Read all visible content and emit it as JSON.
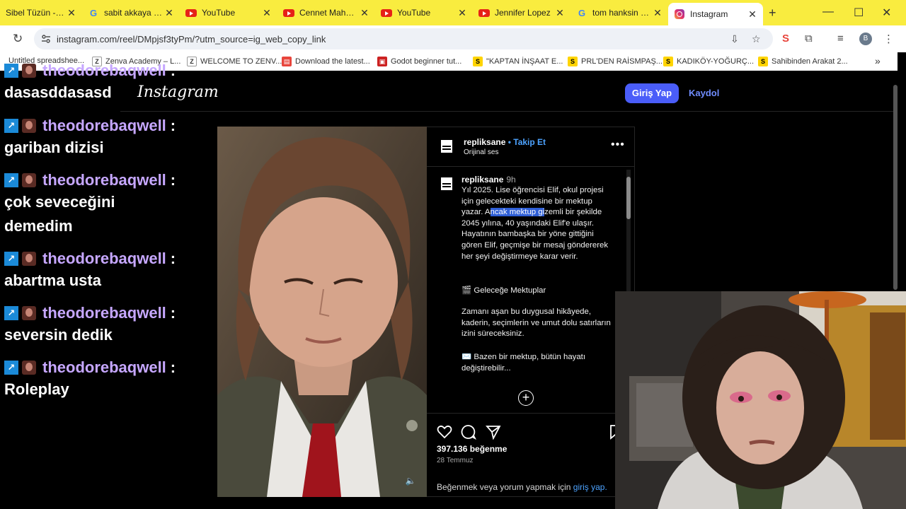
{
  "browser": {
    "tabs": [
      {
        "title": "Sibel Tüzün - Su",
        "icon": "youtube-icon"
      },
      {
        "title": "sabit akkaya - G",
        "icon": "google-icon"
      },
      {
        "title": "YouTube",
        "icon": "youtube-icon"
      },
      {
        "title": "Cennet Mahalle",
        "icon": "youtube-icon"
      },
      {
        "title": "YouTube",
        "icon": "youtube-icon"
      },
      {
        "title": "Jennifer Lopez",
        "icon": "youtube-icon"
      },
      {
        "title": "tom hanksin üye",
        "icon": "google-icon"
      },
      {
        "title": "Instagram",
        "icon": "instagram-icon"
      }
    ],
    "url": "instagram.com/reel/DMpjsf3tyPm/?utm_source=ig_web_copy_link",
    "profile_initial": "B",
    "bookmarks": [
      {
        "label": "Untitled spreadshee...",
        "icon": "sheets-icon"
      },
      {
        "label": "Zenva Academy – L...",
        "icon": "zenva-icon"
      },
      {
        "label": "WELCOME TO ZENV...",
        "icon": "zenva-icon"
      },
      {
        "label": "Download the latest...",
        "icon": "download-icon"
      },
      {
        "label": "Godot beginner tut...",
        "icon": "godot-icon"
      },
      {
        "label": "\"KAPTAN İNŞAAT E...",
        "icon": "sahibinden-icon"
      },
      {
        "label": "PRL'DEN RAİSMPAŞ...",
        "icon": "sahibinden-icon"
      },
      {
        "label": "KADIKÖY-YOĞURÇ...",
        "icon": "sahibinden-icon"
      },
      {
        "label": "Sahibinden Arakat 2...",
        "icon": "sahibinden-icon"
      }
    ]
  },
  "instagram": {
    "logo": "Instagram",
    "login_button": "Giriş Yap",
    "signup_link": "Kaydol",
    "post": {
      "author": "repliksane",
      "follow_label": "• Takip Et",
      "audio": "Orijinal ses",
      "caption_user": "repliksane",
      "caption_time": "9h",
      "caption_line1_a": "Yıl 2025. Lise öğrencisi Elif, okul projesi için gelecekteki kendisine bir mektup yazar. A",
      "caption_line1_hl": "ncak mektup gi",
      "caption_line1_b": "zemli bir şekilde 2045 yılına, 40 yaşındaki Elif'e ulaşır. Hayatının bambaşka bir yöne gittiğini gören Elif, geçmişe bir mesaj göndererek her şeyi değiştirmeye karar verir.",
      "caption_line2": "🎬 Geleceğe Mektuplar",
      "caption_line3": "Zamanı aşan bu duygusal hikâyede, kaderin, seçimlerin ve umut dolu satırların izini süreceksiniz.",
      "caption_line4": "✉️ Bazen bir mektup, bütün hayatı değiştirebilir...",
      "likes": "397.136 beğenme",
      "date": "28 Temmuz",
      "login_prompt": "Beğenmek veya yorum yapmak için",
      "login_prompt_link": "giriş yap."
    }
  },
  "chat": {
    "messages": [
      {
        "user": "theodorebaqwell",
        "text": "dasasddasasd"
      },
      {
        "user": "theodorebaqwell",
        "text": "gariban dizisi"
      },
      {
        "user": "theodorebaqwell",
        "text": "çok seveceğini demedim"
      },
      {
        "user": "theodorebaqwell",
        "text": "abartma usta"
      },
      {
        "user": "theodorebaqwell",
        "text": "seversin dedik"
      },
      {
        "user": "theodorebaqwell",
        "text": "Roleplay"
      }
    ],
    "colon": ":"
  },
  "colors": {
    "tabstrip": "#f9ec3f",
    "ig_blue": "#4a5df9",
    "chat_username": "#c6a7ff"
  }
}
